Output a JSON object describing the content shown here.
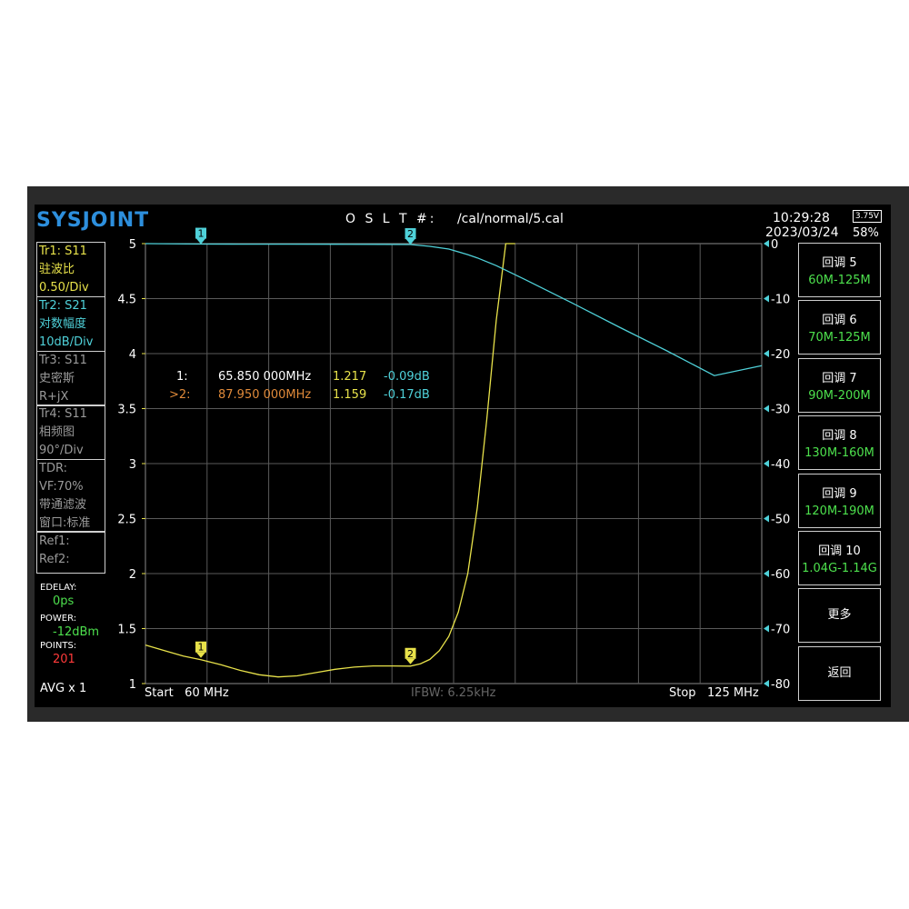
{
  "app": {
    "logo": "SYSJOINT"
  },
  "header": {
    "cal_label": "O S L T #:",
    "cal_path": "/cal/normal/5.cal",
    "time": "10:29:28",
    "date": "2023/03/24",
    "battery_voltage": "3.75V",
    "battery_percent": "58%"
  },
  "traces": [
    {
      "line1": "Tr1:   S11",
      "line2": "驻波比",
      "line3": "0.50/Div",
      "color": "#e8e24a"
    },
    {
      "line1": "Tr2:   S21",
      "line2": "对数幅度",
      "line3": "10dB/Div",
      "color": "#4fd1d9"
    },
    {
      "line1": "Tr3:   S11",
      "line2": "史密斯",
      "line3": "R+jX",
      "color": "#9a9a9a"
    },
    {
      "line1": "Tr4:   S11",
      "line2": "相频图",
      "line3": "90°/Div",
      "color": "#9a9a9a"
    }
  ],
  "tdr": {
    "line1": "TDR:",
    "line2": "VF:70%",
    "line3": "带通滤波",
    "line4": "窗口:标准"
  },
  "refs": {
    "ref1": "Ref1:",
    "ref2": "Ref2:"
  },
  "settings": {
    "edelay_label": "EDELAY:",
    "edelay_value": "0ps",
    "power_label": "POWER:",
    "power_value": "-12dBm",
    "points_label": "POINTS:",
    "points_value": "201",
    "avg": "AVG x 1"
  },
  "markers": {
    "m1": {
      "label": "1:",
      "freq": "65.850 000MHz",
      "swr": "1.217",
      "db": "-0.09dB"
    },
    "m2": {
      "label": ">2:",
      "freq": "87.950 000MHz",
      "swr": "1.159",
      "db": "-0.17dB"
    }
  },
  "footer": {
    "start_label": "Start",
    "start_value": "60 MHz",
    "ifbw": "IFBW: 6.25kHz",
    "stop_label": "Stop",
    "stop_value": "125 MHz"
  },
  "sidebar": {
    "buttons": [
      {
        "title": "回调 5",
        "range": "60M-125M"
      },
      {
        "title": "回调 6",
        "range": "70M-125M"
      },
      {
        "title": "回调 7",
        "range": "90M-200M"
      },
      {
        "title": "回调 8",
        "range": "130M-160M"
      },
      {
        "title": "回调 9",
        "range": "120M-190M"
      },
      {
        "title": "回调 10",
        "range": "1.04G-1.14G"
      }
    ],
    "more": "更多",
    "back": "返回"
  },
  "chart_data": {
    "type": "line",
    "x_range_mhz": [
      60,
      125
    ],
    "left_axis": {
      "ticks": [
        "5",
        "4.5",
        "4",
        "3.5",
        "3",
        "2.5",
        "2",
        "1.5",
        "1"
      ],
      "range": [
        1,
        5
      ]
    },
    "right_axis": {
      "ticks": [
        "0",
        "-10",
        "-20",
        "-30",
        "-40",
        "-50",
        "-60",
        "-70",
        "-80"
      ],
      "range": [
        -80,
        0
      ]
    },
    "grid": true,
    "series": [
      {
        "axis": "left",
        "color": "#e8e24a",
        "x": [
          60,
          62,
          64,
          65.85,
          68,
          70,
          72,
          74,
          76,
          78,
          80,
          82,
          84,
          86,
          87.95,
          89,
          90,
          91,
          92,
          93,
          94,
          95,
          96,
          97,
          98,
          99
        ],
        "y": [
          1.35,
          1.3,
          1.25,
          1.217,
          1.17,
          1.12,
          1.08,
          1.06,
          1.07,
          1.1,
          1.13,
          1.15,
          1.16,
          1.16,
          1.159,
          1.18,
          1.22,
          1.3,
          1.43,
          1.65,
          2.0,
          2.6,
          3.4,
          4.3,
          5.0,
          5.0
        ]
      },
      {
        "axis": "right",
        "color": "#4fd1d9",
        "x": [
          60,
          65.85,
          70,
          75,
          80,
          85,
          87.95,
          90,
          92,
          94,
          95,
          97,
          100,
          105,
          110,
          115,
          120,
          125
        ],
        "y": [
          0,
          -0.09,
          -0.1,
          -0.1,
          -0.12,
          -0.14,
          -0.17,
          -0.5,
          -1.0,
          -2.0,
          -2.6,
          -4.0,
          -6.5,
          -10.8,
          -15.2,
          -19.5,
          -24.0,
          -22.2
        ]
      }
    ]
  }
}
